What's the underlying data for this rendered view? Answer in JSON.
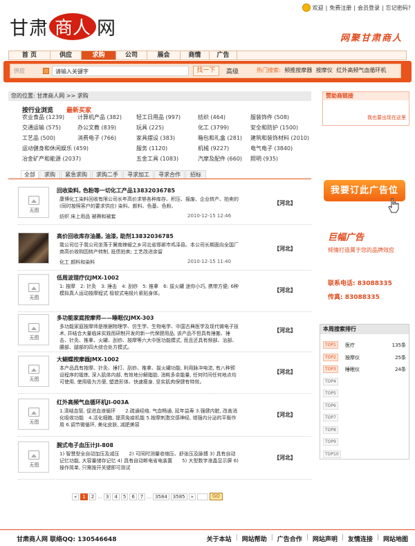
{
  "top": {
    "welcome": "欢迎",
    "register": "免费注册",
    "login": "会员登录",
    "forgot": "忘记密码?"
  },
  "logo": {
    "left": "甘肃",
    "mid": "商人",
    "right": "网"
  },
  "slogan": "网聚甘肃商人",
  "nav": [
    {
      "label": "首 页",
      "w": 60
    },
    {
      "label": "供应",
      "w": 45
    },
    {
      "label": "求购",
      "w": 50,
      "active": true
    },
    {
      "label": "公司",
      "w": 45
    },
    {
      "label": "展会",
      "w": 48
    },
    {
      "label": "商情",
      "w": 42
    },
    {
      "label": "广告",
      "w": 40
    }
  ],
  "search": {
    "category": "供应",
    "placeholder": "请输入关键字",
    "button": "找一下",
    "advanced": "高级",
    "hot_label": "热门搜索:",
    "hot_words": [
      "频推按摩器",
      "按摩仪",
      "红外高频气血循环机"
    ]
  },
  "breadcrumb": "您的位置: 甘肃商人网 >> 求购",
  "categories": {
    "browse": "按行业浏览",
    "newest": "最新买家",
    "rows": [
      [
        "农业食品 (1239)",
        "计算机产品 (382)",
        "轻工日用品 (997)",
        "纺织 (464)",
        "服装饰件 (508)"
      ],
      [
        "交通运输 (575)",
        "办公文教 (839)",
        "玩具 (225)",
        "化工 (3799)",
        "安全和防护 (1500)"
      ],
      [
        "工艺品 (500)",
        "消费电子 (766)",
        "家具摆设 (383)",
        "箱包和礼盒 (281)",
        "建筑和装饰材料 (2010)"
      ],
      [
        "运动健身和休闲娱乐 (459)",
        "",
        "服务 (1120)",
        "机械 (9227)",
        "电气电子 (3840)"
      ],
      [
        "冶金矿产和能源 (2037)",
        "",
        "五金工具 (1083)",
        "汽摩及配件 (660)",
        "照明 (935)"
      ]
    ]
  },
  "tabs": [
    "全部",
    "求购",
    "紧急求购",
    "求购二手",
    "寻求加工",
    "寻求合作",
    "招标"
  ],
  "listings": [
    {
      "title": "回收染料, 色粉等一切化工产品13832036785",
      "desc": "康博化工染料回收有限公司长年高价求够各种库存、积压、报废、企业转产、拍卖的 (同时按照客户的要求供应) 染料、颜料、色基、色粉、",
      "tags": "纺织 床上用品 被褥和被套",
      "date": "2010-12-15 12:46",
      "province": "【河北】",
      "photo": false
    },
    {
      "title": "高价回收库存油墨, 油漆, 助剂13832036785",
      "desc": "我公司位于我公司坐落于冀南辣椒之乡河北省邯郸市鸡泽县。本公司长期面向全国厂商高价收购因转产转制, 抵债拍卖; 工艺改进余留",
      "tags": "化工 颜料和染料",
      "date": "2010-12-15 11:40",
      "province": "【河北】",
      "photo": true
    },
    {
      "title": "低周波理疗仪JMX-1002",
      "desc": "1: 按摩　2: 针灸　3: 捶击　4: 刮痧　5: 推拿　6: 拔火罐 迷你小巧, 携带方便; 6种模拟真人运动按摩程式 极软式电极片紧贴身体。",
      "tags": "",
      "date": "",
      "province": "【河北】",
      "photo": false
    },
    {
      "title": "多功能家庭按摩师——睡眠仪JMX-303",
      "desc": "多功能家庭按摩师是根据物理学、仿生学、生物电学、中国古典医学及现代微电子技术, 并结合大量临床实践而研制开发的新一代保健用品, 该产品不但具有捶搬、捶击、针灸、推拿、火罐、刮痧、按摩等六大中医功能模式, 而且还具有频部、治部、腰部、腿部的四大综合处方模式。",
      "tags": "",
      "date": "",
      "province": "【河北】",
      "photo": false
    },
    {
      "title": "大蝴蝶按摩器JMX-1002",
      "desc": "本产品具有按摩、针灸、捶打、刮痧、推拿、拔火罐功能, 利用脉冲电流, 有八种预设程序的锻炼, 深入肌体内部, 有效地分解脂肪, 消耗多余能量, 任何时间任何地点均可使用, 使用极为方便, 塑造形体、快速瘦身, 坚实肌肉保健有特效。",
      "tags": "",
      "date": "",
      "province": "【河北】",
      "photo": false
    },
    {
      "title": "红外高频气血循环机JI-003A",
      "desc": "1.清结血管, 促进血液循环　　2.疏通经络, 气血畅通, 延年益寿 3.强健内脏, 改善消化吸收功能　4.活化细胞, 提高免疫机能 5.按摩刺激交感神经, 增强内分泌的平衡作用 6.调节微循环, 美化皮肤, 减肥美容",
      "tags": "",
      "date": "",
      "province": "【河北】",
      "photo": false
    },
    {
      "title": "腕式电子血压计JI-808",
      "desc": "1) 智慧型全自动加压及减压　　2) 可同时测量收缩压、舒张压及脉搏 3) 具有自动记忆功能, 大容量储存记忆 4) 具有自动断电省电装置　　5) 大型数字液晶显示屏 6) 操作简单, 只需按开关键即可测试",
      "tags": "",
      "date": "",
      "province": "【河北】",
      "photo": false
    }
  ],
  "pager": {
    "prev": "«",
    "pages": [
      "1",
      "2",
      "...",
      "3",
      "4",
      "5",
      "6",
      "7",
      "...",
      "3584",
      "3585"
    ],
    "next": "»",
    "go": "GO"
  },
  "sponsor": {
    "title": "赞助商链接",
    "link": "我也要出现在这里"
  },
  "ad": {
    "button": "我要订此广告位",
    "title": "巨幅广告",
    "subtitle": "倾情打造属于您的品牌效应",
    "phone": "联系电话: 83088335",
    "fax": "传真: 83088335"
  },
  "ranking": {
    "title": "本周搜索排行",
    "rows": [
      {
        "tag": "TOP1",
        "name": "医疗",
        "count": "135条",
        "hot": true
      },
      {
        "tag": "TOP2",
        "name": "按摩仪",
        "count": "25条",
        "hot": true
      },
      {
        "tag": "TOP3",
        "name": "睡眠仪",
        "count": "24条",
        "hot": true
      },
      {
        "tag": "TOP4",
        "name": "",
        "count": ""
      },
      {
        "tag": "TOP5",
        "name": "",
        "count": ""
      },
      {
        "tag": "TOP6",
        "name": "",
        "count": ""
      },
      {
        "tag": "TOP7",
        "name": "",
        "count": ""
      },
      {
        "tag": "TOP8",
        "name": "",
        "count": ""
      },
      {
        "tag": "TOP9",
        "name": "",
        "count": ""
      },
      {
        "tag": "TOP10",
        "name": "",
        "count": ""
      }
    ]
  },
  "footer": {
    "left": "甘肃商人网 联络QQ: 130546648",
    "links": [
      "关于本站",
      "网站帮助",
      "广告合作",
      "网站声明",
      "友情连接",
      "网站地图"
    ]
  },
  "colors": {
    "accent": "#e0521b",
    "brand": "#d32011"
  },
  "icons": [
    "smile-icon",
    "no-image-icon",
    "hand-cursor-icon",
    "dropdown-icon"
  ]
}
